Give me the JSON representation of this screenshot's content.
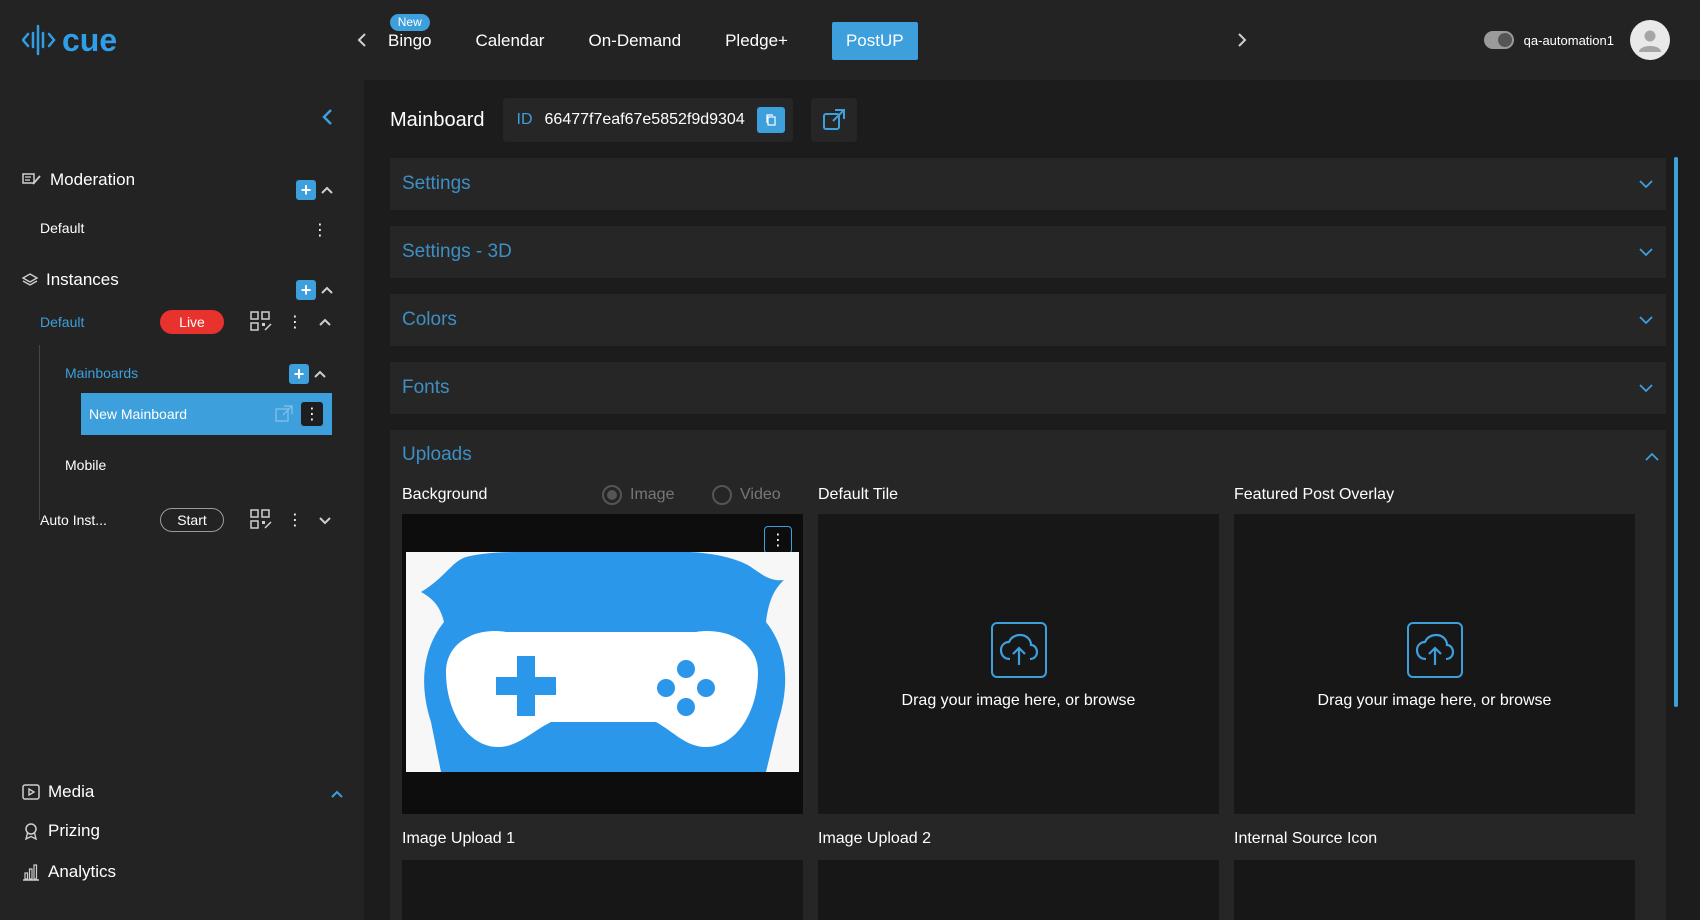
{
  "app": {
    "logo_text": "cue"
  },
  "topnav": {
    "tabs": [
      {
        "label": "Bingo",
        "badge": "New"
      },
      {
        "label": "Calendar"
      },
      {
        "label": "On-Demand"
      },
      {
        "label": "Pledge+"
      },
      {
        "label": "PostUP",
        "active": true
      }
    ],
    "username": "qa-automation1"
  },
  "sidebar": {
    "moderation": {
      "label": "Moderation",
      "items": [
        {
          "label": "Default"
        }
      ]
    },
    "instances": {
      "label": "Instances",
      "items": [
        {
          "label": "Default",
          "status": "Live"
        },
        {
          "label": "Auto Inst...",
          "action": "Start"
        }
      ],
      "mainboards": {
        "label": "Mainboards",
        "items": [
          {
            "label": "New Mainboard",
            "selected": true
          }
        ]
      },
      "mobile": {
        "label": "Mobile"
      }
    },
    "bottom": [
      {
        "label": "Media",
        "icon": "media-icon"
      },
      {
        "label": "Prizing",
        "icon": "award-icon"
      },
      {
        "label": "Analytics",
        "icon": "bar-chart-icon"
      }
    ]
  },
  "main": {
    "title": "Mainboard",
    "id_label": "ID",
    "id_value": "66477f7eaf67e5852f9d9304",
    "sections": [
      {
        "label": "Settings",
        "expanded": false
      },
      {
        "label": "Settings - 3D",
        "expanded": false
      },
      {
        "label": "Colors",
        "expanded": false
      },
      {
        "label": "Fonts",
        "expanded": false
      },
      {
        "label": "Uploads",
        "expanded": true
      }
    ],
    "uploads": {
      "background": {
        "label": "Background",
        "radio_image": "Image",
        "radio_video": "Video",
        "selected": "Image"
      },
      "default_tile": {
        "label": "Default Tile",
        "drop_text": "Drag your image here, or browse"
      },
      "featured_overlay": {
        "label": "Featured Post Overlay",
        "drop_text": "Drag your image here, or browse"
      },
      "image_upload_1": {
        "label": "Image Upload 1"
      },
      "image_upload_2": {
        "label": "Image Upload 2"
      },
      "internal_source_icon": {
        "label": "Internal Source Icon"
      }
    }
  },
  "colors": {
    "accent": "#3d9fdc",
    "live": "#e8322e",
    "bg": "#1c1c1c",
    "panel": "#262626"
  }
}
